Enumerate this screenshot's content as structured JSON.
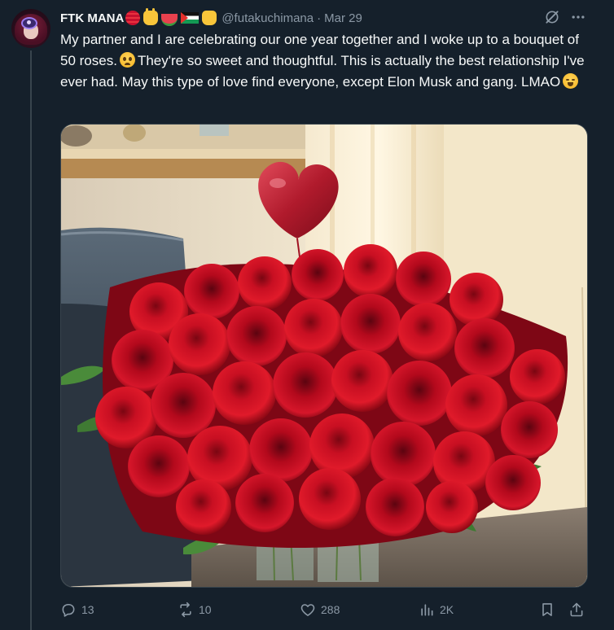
{
  "tweet": {
    "author": {
      "display_name": "FTK MANA",
      "handle": "@futakuchimana",
      "avatar": "avatar"
    },
    "separator": "·",
    "timestamp": "Mar 29",
    "text_part1": "My partner and I are celebrating our one year together and I woke up to a bouquet of 50 roses.",
    "text_part2": "They're so sweet and thoughtful. This is actually the best relationship I've ever had. May this type of love find everyone, except Elon Musk and gang. LMAO",
    "name_emojis": [
      "stop-sign-emoji",
      "sign-of-the-horns-emoji",
      "watermelon-emoji",
      "palestine-flag-emoji",
      "raised-fist-emoji"
    ],
    "media": {
      "kind": "photo"
    },
    "actions": {
      "replies": "13",
      "reposts": "10",
      "likes": "288",
      "views": "2K"
    },
    "icons": {
      "grok": "grok-icon",
      "more": "more-icon",
      "reply": "reply-icon",
      "repost": "repost-icon",
      "like": "heart-icon",
      "views": "views-icon",
      "bookmark": "bookmark-icon",
      "share": "share-icon"
    },
    "colors": {
      "background": "#15202b",
      "text": "#f7f9f9",
      "muted": "#8b98a5",
      "border": "#38444d"
    }
  }
}
